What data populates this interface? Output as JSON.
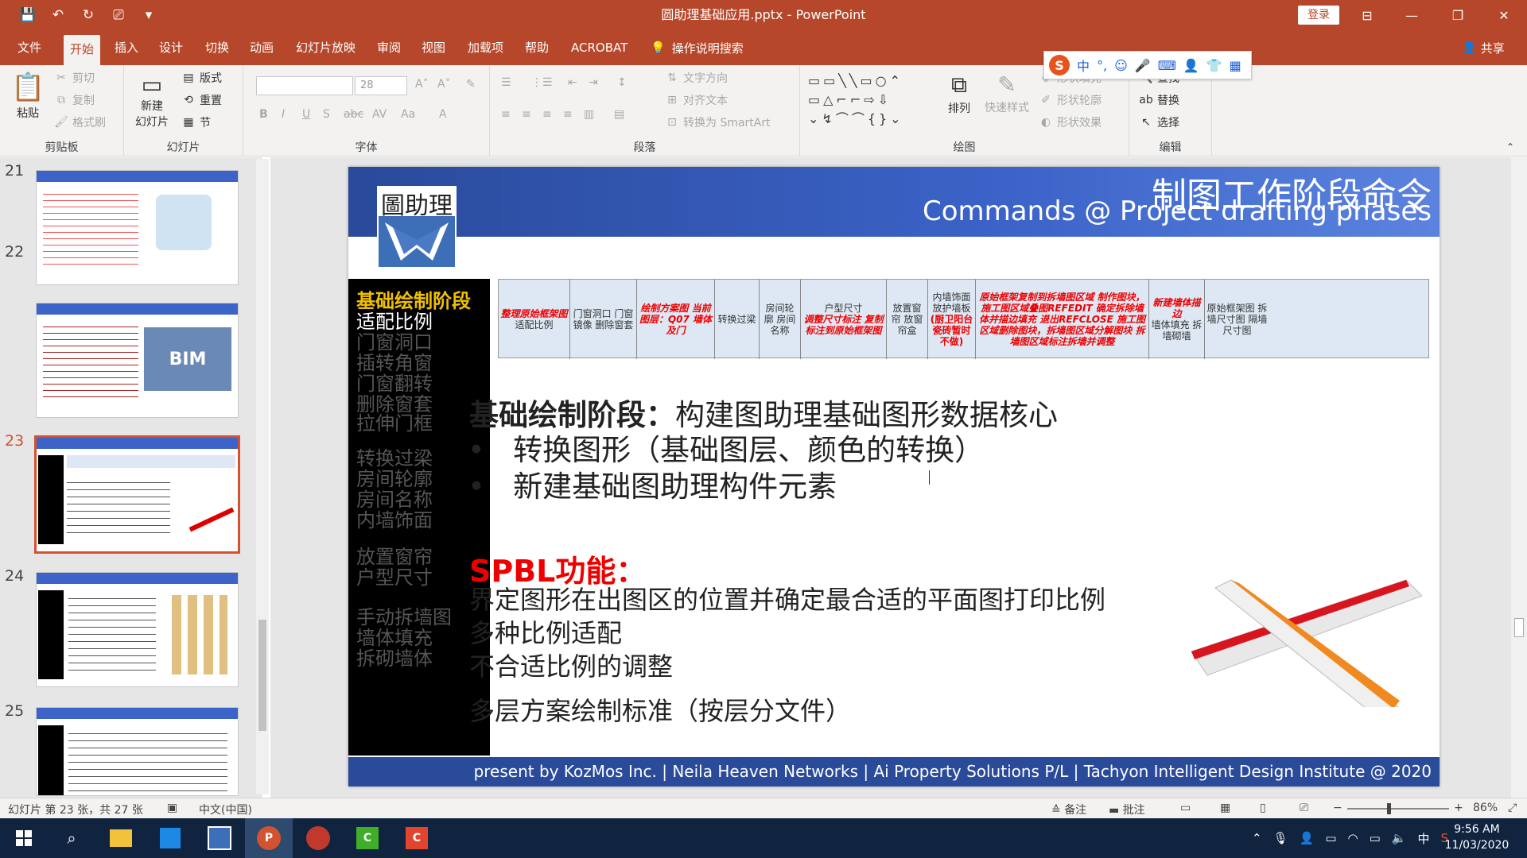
{
  "window": {
    "title": "圆助理基础应用.pptx - PowerPoint",
    "login_label": "登录",
    "minimize": "—",
    "restore": "❐",
    "close": "✕",
    "ribbon_display": "⊟"
  },
  "qat": {
    "save": "💾",
    "undo": "↶",
    "redo": "↻",
    "present": "⎚",
    "customize": "▾"
  },
  "tabs": [
    "文件",
    "开始",
    "插入",
    "设计",
    "切换",
    "动画",
    "幻灯片放映",
    "审阅",
    "视图",
    "加载项",
    "帮助",
    "ACROBAT"
  ],
  "active_tab": "开始",
  "tell_me": "操作说明搜索",
  "share": "共享",
  "ribbon": {
    "clipboard": {
      "label": "剪贴板",
      "paste": "粘贴",
      "cut": "剪切",
      "copy": "复制",
      "format_painter": "格式刷"
    },
    "slides": {
      "label": "幻灯片",
      "new_slide": "新建",
      "new_slide2": "幻灯片",
      "layout": "版式",
      "reset": "重置",
      "section": "节"
    },
    "font": {
      "label": "字体",
      "size": "28"
    },
    "paragraph": {
      "label": "段落",
      "text_direction": "文字方向",
      "align_text": "对齐文本",
      "smartart": "转换为 SmartArt"
    },
    "drawing": {
      "label": "绘图",
      "arrange": "排列",
      "quick_styles": "快速样式",
      "shape_fill": "形状填充",
      "shape_outline": "形状轮廓",
      "shape_effects": "形状效果"
    },
    "editing": {
      "label": "编辑",
      "find": "查找",
      "replace": "替换",
      "select": "选择"
    }
  },
  "ime": {
    "logo": "S",
    "items": [
      "中",
      "°,",
      "☺",
      "🎤",
      "⌨",
      "👤",
      "👕",
      "▦"
    ]
  },
  "thumbnails": [
    {
      "num": "21"
    },
    {
      "num": "22"
    },
    {
      "num": "23"
    },
    {
      "num": "24"
    },
    {
      "num": "25"
    }
  ],
  "slide": {
    "title_cn": "制图工作阶段命令",
    "title_en": "Commands @ Project drafting phases",
    "logo_text": "圖助理",
    "left_items": [
      {
        "text": "基础绘制阶段",
        "style": "hl"
      },
      {
        "text": "适配比例",
        "style": "cur"
      },
      {
        "text": "门窗洞口",
        "style": ""
      },
      {
        "text": "插转角窗",
        "style": ""
      },
      {
        "text": "门窗翻转",
        "style": ""
      },
      {
        "text": "删除窗套",
        "style": ""
      },
      {
        "text": "拉伸门框",
        "style": ""
      },
      {
        "text": "转换过梁",
        "style": ""
      },
      {
        "text": "房间轮廓",
        "style": ""
      },
      {
        "text": "房间名称",
        "style": ""
      },
      {
        "text": "内墙饰面",
        "style": ""
      },
      {
        "text": "放置窗帘",
        "style": ""
      },
      {
        "text": "户型尺寸",
        "style": ""
      },
      {
        "text": "手动拆墙图",
        "style": ""
      },
      {
        "text": "墙体填充",
        "style": ""
      },
      {
        "text": "拆砌墙体",
        "style": ""
      }
    ],
    "phase_cells": [
      {
        "red": "整理原始框架图",
        "black": "适配比例"
      },
      {
        "red": "",
        "black": "门窗洞口 门窗镜像 删除窗套"
      },
      {
        "red": "绘制方案图 当前图层：Q07 墙体及门",
        "black": ""
      },
      {
        "red": "",
        "black": "转换过梁"
      },
      {
        "red": "",
        "black": "房间轮廓 房间名称"
      },
      {
        "red": "调整尺寸标注 复制标注到原始框架图",
        "black": "户型尺寸"
      },
      {
        "red": "",
        "black": "放置窗帘 放窗帘盒"
      },
      {
        "red": "(厨卫阳台瓷砖暂时不做)",
        "black": "内墙饰面 放护墙板"
      },
      {
        "red": "原始框架复制到拆墙图区域 制作图块，施工图区域叠图REFEDIT 确定拆除墙体并描边填充 退出REFCLOSE 施工图区域删除图块，拆墙图区域分解图块 拆墙图区域标注拆墙并调整",
        "black": ""
      },
      {
        "red": "新建墙体描边",
        "black": "墙体填充 拆墙砌墙"
      },
      {
        "red": "",
        "black": "原始框架图 拆墙尺寸图 隔墙尺寸图"
      }
    ],
    "heading_bold": "基础绘制阶段：",
    "heading_rest": "构建图助理基础图形数据核心",
    "bullets": [
      "转换图形（基础图层、颜色的转换）",
      "新建基础图助理构件元素"
    ],
    "red_heading": "SPBL功能：",
    "body_lines": [
      "界定图形在出图区的位置并确定最合适的平面图打印比例",
      "多种比例适配",
      "不合适比例的调整",
      "多层方案绘制标准（按层分文件）"
    ],
    "footer": "present by KozMos Inc. | Neila Heaven Networks | Ai Property Solutions P/L | Tachyon Intelligent Design Institute @ 2020"
  },
  "status": {
    "slide_info": "幻灯片 第 23 张，共 27 张",
    "language": "中文(中国)",
    "notes": "备注",
    "comments": "批注",
    "zoom": "86%"
  },
  "taskbar": {
    "time": "9:56 AM",
    "date": "11/03/2020",
    "ime_lang": "中"
  },
  "colors": {
    "brand": "#b7472a",
    "slide_blue": "#2a4a9a",
    "highlight_yellow": "#f0c000",
    "accent_red": "#e00000"
  }
}
